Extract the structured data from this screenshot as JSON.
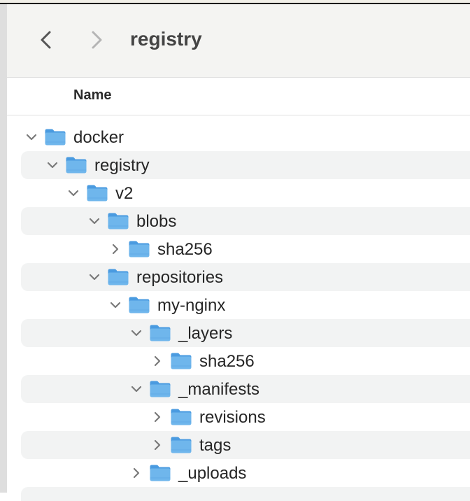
{
  "window": {
    "title": "registry"
  },
  "toolbar": {
    "back_icon": "chevron-left-icon",
    "forward_icon": "chevron-right-icon"
  },
  "header": {
    "name_column": "Name"
  },
  "colors": {
    "folder": "#6fb6ec",
    "folder_tab": "#4a9be0",
    "stripe": "#f2f3f3"
  },
  "tree": [
    {
      "name": "docker",
      "depth": 0,
      "expanded": true
    },
    {
      "name": "registry",
      "depth": 1,
      "expanded": true
    },
    {
      "name": "v2",
      "depth": 2,
      "expanded": true
    },
    {
      "name": "blobs",
      "depth": 3,
      "expanded": true
    },
    {
      "name": "sha256",
      "depth": 4,
      "expanded": false
    },
    {
      "name": "repositories",
      "depth": 3,
      "expanded": true
    },
    {
      "name": "my-nginx",
      "depth": 4,
      "expanded": true
    },
    {
      "name": "_layers",
      "depth": 5,
      "expanded": true
    },
    {
      "name": "sha256",
      "depth": 6,
      "expanded": false
    },
    {
      "name": "_manifests",
      "depth": 5,
      "expanded": true
    },
    {
      "name": "revisions",
      "depth": 6,
      "expanded": false
    },
    {
      "name": "tags",
      "depth": 6,
      "expanded": false
    },
    {
      "name": "_uploads",
      "depth": 5,
      "expanded": false
    }
  ]
}
